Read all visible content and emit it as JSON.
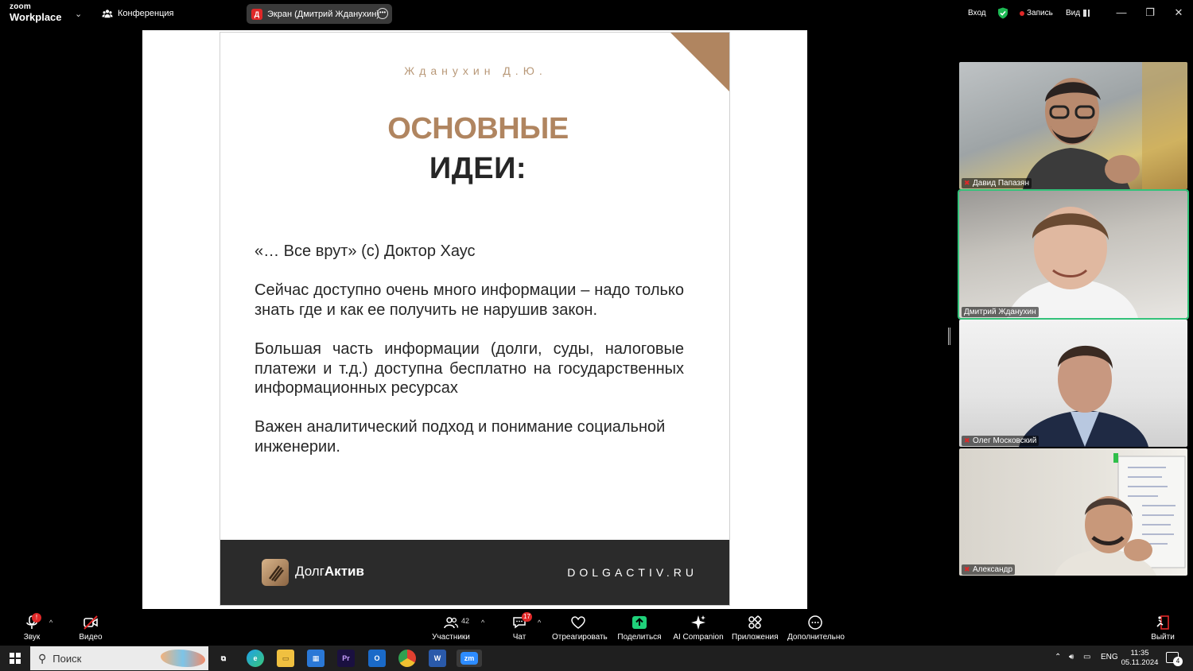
{
  "topbar": {
    "brand_small": "zoom",
    "brand_big": "Workplace",
    "conference_label": "Конференция",
    "share_badge": "Д",
    "share_title": "Экран (Дмитрий Жданухин)",
    "login_label": "Вход",
    "record_label": "Запись",
    "view_label": "Вид",
    "colors": {
      "record_dot": "#e02828",
      "shield": "#1db954"
    }
  },
  "slide": {
    "author": "Жданухин Д.Ю.",
    "title_line1": "ОСНОВНЫЕ",
    "title_line2": "ИДЕИ:",
    "paragraphs": [
      "«… Все врут» (с) Доктор Хаус",
      "Сейчас доступно очень много информации – надо только знать где и как ее получить не нарушив закон.",
      "Большая часть информации (долги, суды, налоговые платежи и т.д.) доступна бесплатно на государственных информационных ресурсах",
      "Важен аналитический подход и понимание социальной инженерии."
    ],
    "footer_logo_regular": "Долг",
    "footer_logo_bold": "Актив",
    "footer_site": "DOLGACTIV.RU",
    "colors": {
      "accent": "#b08560",
      "dark": "#262626",
      "footer_bg": "#2b2b2b"
    }
  },
  "participants": [
    {
      "name": "Давид Папазян",
      "muted": true,
      "active": false
    },
    {
      "name": "Дмитрий Жданухин",
      "muted": false,
      "active": true
    },
    {
      "name": "Олег Московский",
      "muted": true,
      "active": false
    },
    {
      "name": "Александр",
      "muted": true,
      "active": false
    }
  ],
  "toolbar": {
    "audio_label": "Звук",
    "audio_badge": "!",
    "video_label": "Видео",
    "participants_label": "Участники",
    "participants_count": "42",
    "chat_label": "Чат",
    "chat_badge": "17",
    "react_label": "Отреагировать",
    "share_label": "Поделиться",
    "ai_label": "AI Companion",
    "apps_label": "Приложения",
    "more_label": "Дополнительно",
    "leave_label": "Выйти",
    "colors": {
      "share_green": "#1fd17a",
      "leave_red": "#e02828"
    }
  },
  "taskbar": {
    "search_label": "Поиск",
    "lang": "ENG",
    "time": "11:35",
    "date": "05.11.2024",
    "notifications_count": "4"
  }
}
